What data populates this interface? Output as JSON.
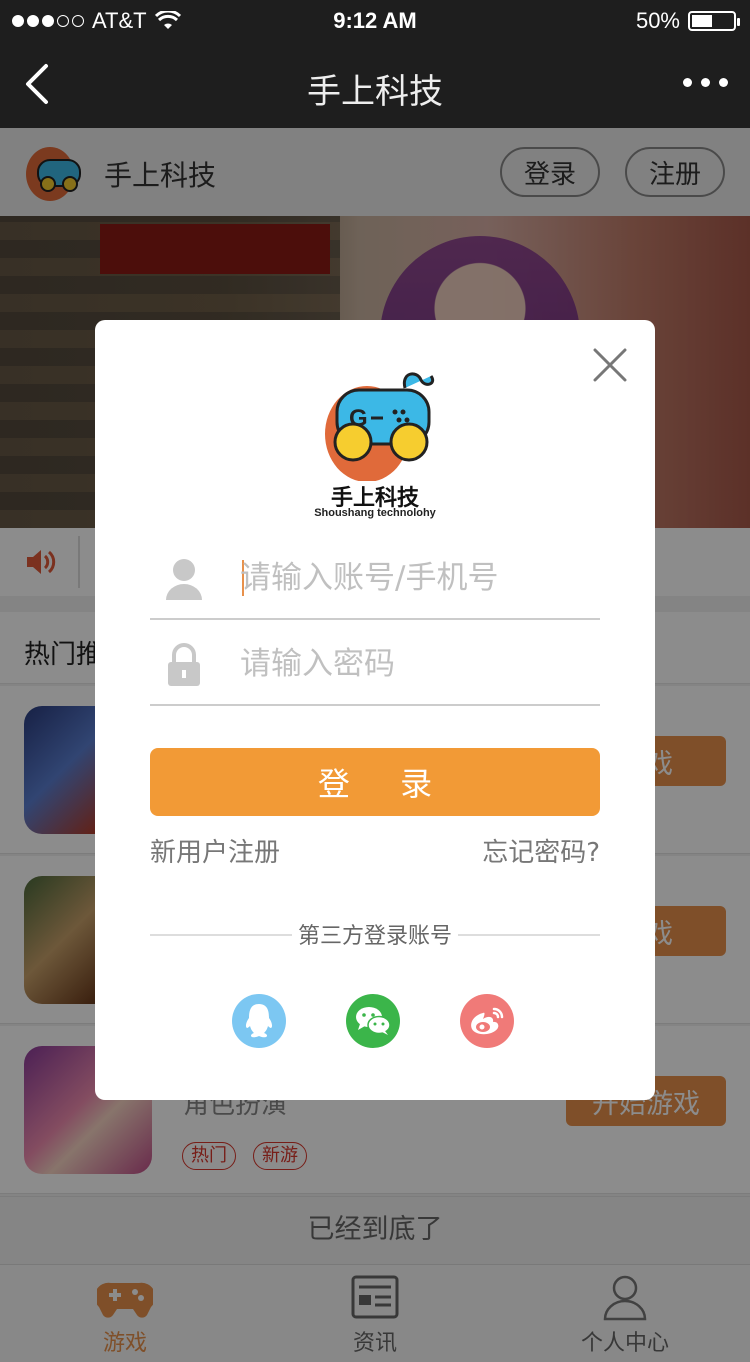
{
  "status_bar": {
    "carrier": "AT&T",
    "time": "9:12 AM",
    "battery": "50%",
    "battery_level": 0.5
  },
  "nav": {
    "title": "手上科技"
  },
  "header": {
    "app_name": "手上科技",
    "login_label": "登录",
    "register_label": "注册"
  },
  "section": {
    "title": "热门推"
  },
  "games": [
    {
      "genre": "",
      "tags": [],
      "button": "游戏"
    },
    {
      "genre": "",
      "tags": [],
      "button": "游戏"
    },
    {
      "genre": "角色扮演",
      "tags": [
        "热门",
        "新游"
      ],
      "button": "开始游戏"
    }
  ],
  "footer": {
    "end_note": "已经到底了"
  },
  "tabs": [
    {
      "label": "游戏",
      "icon": "gamepad-icon",
      "active": true
    },
    {
      "label": "资讯",
      "icon": "news-icon",
      "active": false
    },
    {
      "label": "个人中心",
      "icon": "person-icon",
      "active": false
    }
  ],
  "modal": {
    "brand": "手上科技",
    "brand_en": "Shoushang technolohy",
    "logo_letter": "G",
    "account_placeholder": "请输入账号/手机号",
    "password_placeholder": "请输入密码",
    "login_label": "登 录",
    "register_link": "新用户注册",
    "forgot_link": "忘记密码?",
    "third_party_title": "第三方登录账号",
    "social": [
      "qq-icon",
      "wechat-icon",
      "weibo-icon"
    ]
  },
  "colors": {
    "accent": "#f29a36",
    "play_button": "#e8914b",
    "tag_red": "#d9372c",
    "bar_dark": "#1e1e1e"
  }
}
